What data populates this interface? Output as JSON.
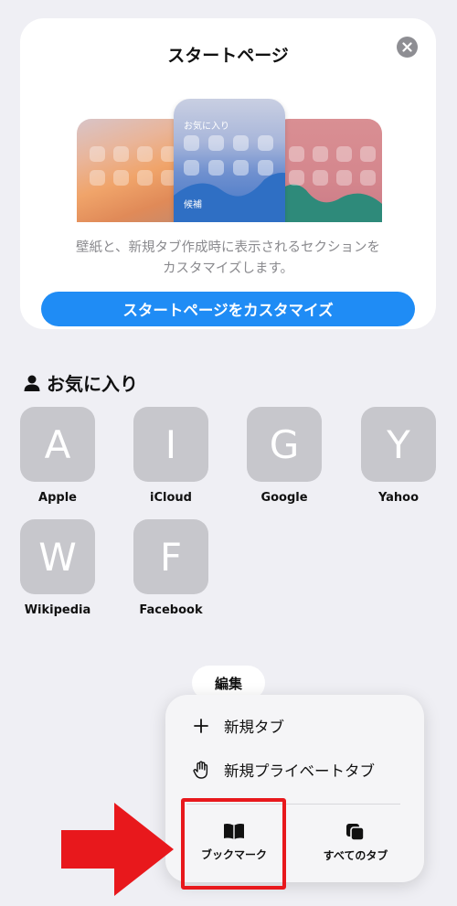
{
  "start_card": {
    "title": "スタートページ",
    "preview": {
      "favorites_label": "お気に入り",
      "suggestions_label": "候補"
    },
    "description_line1": "壁紙と、新規タブ作成時に表示されるセクションを",
    "description_line2": "カスタマイズします。",
    "customize_button": "スタートページをカスタマイズ"
  },
  "favorites": {
    "title": "お気に入り",
    "items": [
      {
        "letter": "A",
        "label": "Apple"
      },
      {
        "letter": "I",
        "label": "iCloud"
      },
      {
        "letter": "G",
        "label": "Google"
      },
      {
        "letter": "Y",
        "label": "Yahoo"
      },
      {
        "letter": "W",
        "label": "Wikipedia"
      },
      {
        "letter": "F",
        "label": "Facebook"
      }
    ]
  },
  "edit_button": "編集",
  "menu": {
    "new_tab": "新規タブ",
    "new_private_tab": "新規プライベートタブ",
    "bookmarks": "ブックマーク",
    "all_tabs": "すべてのタブ"
  },
  "colors": {
    "accent": "#1f8cf5",
    "highlight": "#e8181c",
    "tile": "#c7c7cc"
  }
}
